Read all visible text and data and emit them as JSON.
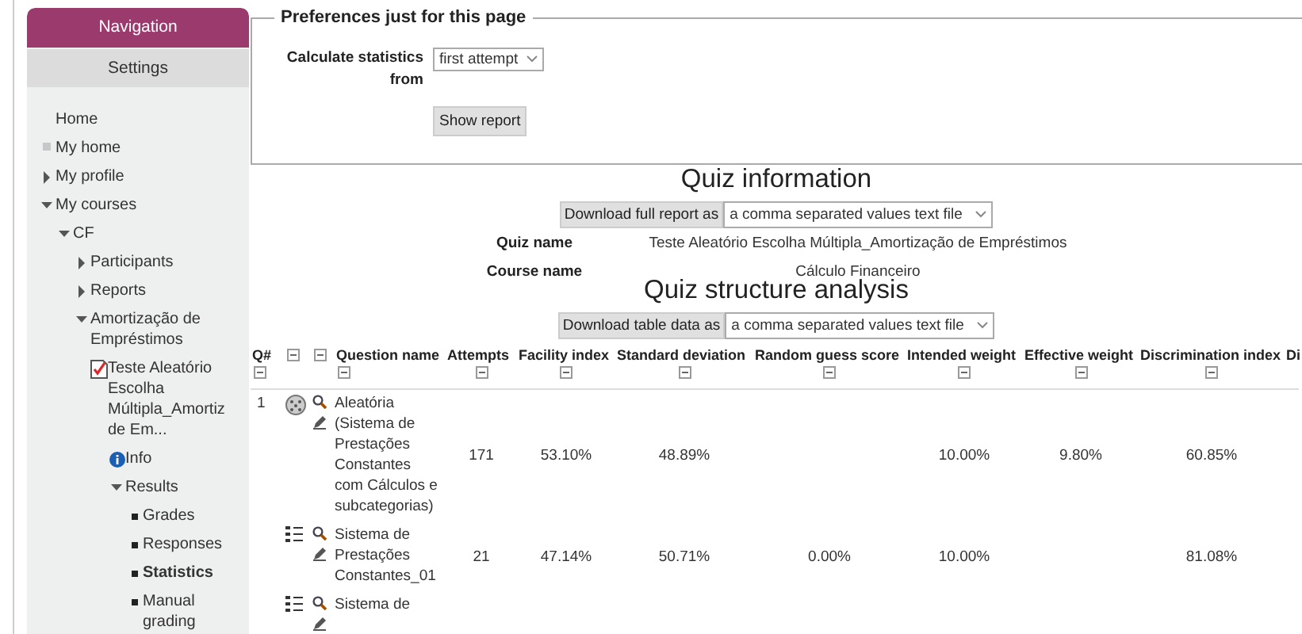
{
  "sidebar": {
    "header": "Navigation",
    "tab": "Settings",
    "items": [
      {
        "kind": "plain",
        "label": "Home",
        "selected": false
      },
      {
        "kind": "page",
        "label": "My home",
        "selected": false
      },
      {
        "kind": "branch",
        "label": "My profile",
        "expanded": false,
        "selected": false
      },
      {
        "kind": "branch",
        "label": "My courses",
        "expanded": true,
        "selected": false,
        "children": [
          {
            "kind": "branch",
            "label": "CF",
            "expanded": true,
            "selected": false,
            "children": [
              {
                "kind": "branch",
                "label": "Participants",
                "expanded": false,
                "selected": false
              },
              {
                "kind": "branch",
                "label": "Reports",
                "expanded": false,
                "selected": false
              },
              {
                "kind": "branch",
                "label": "Amortização de Empréstimos",
                "expanded": true,
                "selected": false,
                "children": [
                  {
                    "kind": "quiz",
                    "label": "Teste Aleatório Escolha Múltipla_Amortiz de Em...",
                    "selected": false,
                    "children": [
                      {
                        "kind": "info",
                        "label": "Info",
                        "selected": false
                      },
                      {
                        "kind": "branch",
                        "label": "Results",
                        "expanded": true,
                        "selected": false,
                        "children": [
                          {
                            "kind": "leaf",
                            "label": "Grades",
                            "selected": false
                          },
                          {
                            "kind": "leaf",
                            "label": "Responses",
                            "selected": false
                          },
                          {
                            "kind": "leaf",
                            "label": "Statistics",
                            "selected": true
                          },
                          {
                            "kind": "leaf",
                            "label": "Manual grading",
                            "selected": false
                          }
                        ]
                      }
                    ]
                  }
                ]
              }
            ]
          }
        ]
      }
    ]
  },
  "preferences": {
    "legend": "Preferences just for this page",
    "label": "Calculate statistics from",
    "value": "first attempt",
    "button": "Show report"
  },
  "quiz_information": {
    "title": "Quiz information",
    "download_button": "Download full report as",
    "download_format": "a comma separated values text file",
    "fields": [
      {
        "label": "Quiz name",
        "value": "Teste Aleatório Escolha Múltipla_Amortização de Empréstimos"
      },
      {
        "label": "Course name",
        "value": "Cálculo Financeiro"
      }
    ]
  },
  "structure_analysis": {
    "title": "Quiz structure analysis",
    "download_button": "Download table data as",
    "download_format": "a comma separated values text file",
    "columns": [
      "Q#",
      "Question name",
      "Attempts",
      "Facility index",
      "Standard deviation",
      "Random guess score",
      "Intended weight",
      "Effective weight",
      "Discrimination index",
      "Di"
    ],
    "rows": [
      {
        "kind": "random",
        "q": "1",
        "name": "Aleatória (Sistema de Prestações Constantes com Cálculos e subcategorias)",
        "attempts": "171",
        "facility": "53.10%",
        "sd": "48.89%",
        "intended": "10.00%",
        "effective": "9.80%",
        "discrimination": "60.85%"
      },
      {
        "kind": "list",
        "name": "Sistema de Prestações Constantes_01",
        "attempts": "21",
        "facility": "47.14%",
        "sd": "50.71%",
        "random_guess": "0.00%",
        "intended": "10.00%",
        "discrimination": "81.08%"
      },
      {
        "kind": "list",
        "name": "Sistema de"
      }
    ]
  }
}
